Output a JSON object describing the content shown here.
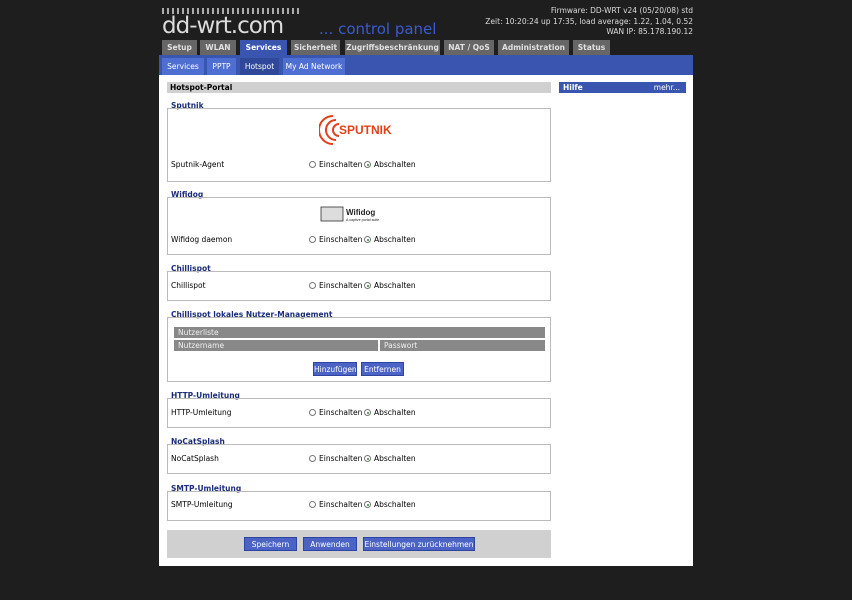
{
  "header": {
    "logo_text": "dd-wrt.com",
    "logo_sub": "... control panel",
    "firmware": "Firmware: DD-WRT v24 (05/20/08) std",
    "uptime": "Zeit: 10:20:24 up 17:35, load average: 1.22, 1.04, 0.52",
    "wan_ip": "WAN IP: 85.178.190.12"
  },
  "tabs": [
    "Setup",
    "WLAN",
    "Services",
    "Sicherheit",
    "Zugriffsbeschränkung",
    "NAT / QoS",
    "Administration",
    "Status"
  ],
  "active_tab": "Services",
  "subtabs": [
    "Services",
    "PPTP",
    "Hotspot",
    "My Ad Network"
  ],
  "active_subtab": "Hotspot",
  "main": {
    "section_title": "Hotspot-Portal",
    "on_label": "Einschalten",
    "off_label": "Abschalten",
    "sputnik": {
      "legend": "Sputnik",
      "label": "Sputnik-Agent",
      "logo_text": "SPUTNIK",
      "value": "off"
    },
    "wifidog": {
      "legend": "Wifidog",
      "label": "Wifidog daemon",
      "logo_text": "Wifidog",
      "logo_sub": "A captive portal suite",
      "value": "off"
    },
    "chillispot": {
      "legend": "Chillispot",
      "label": "Chillispot",
      "value": "off"
    },
    "chilli_users": {
      "legend": "Chillispot lokales Nutzer-Management",
      "list_header": "Nutzerliste",
      "col_user": "Nutzername",
      "col_pass": "Passwort",
      "add_button": "Hinzufügen",
      "remove_button": "Entfernen"
    },
    "http_redirect": {
      "legend": "HTTP-Umleitung",
      "label": "HTTP-Umleitung",
      "value": "off"
    },
    "nocatsplash": {
      "legend": "NoCatSplash",
      "label": "NoCatSplash",
      "value": "off"
    },
    "smtp_redirect": {
      "legend": "SMTP-Umleitung",
      "label": "SMTP-Umleitung",
      "value": "off"
    }
  },
  "buttons": {
    "save": "Speichern",
    "apply": "Anwenden",
    "reset": "Einstellungen zurücknehmen"
  },
  "help": {
    "title": "Hilfe",
    "more": "mehr..."
  },
  "colors": {
    "accent": "#3a55b0",
    "tab_inactive": "#666666",
    "legend": "#1b2d7a",
    "sputnik": "#e0401a"
  }
}
